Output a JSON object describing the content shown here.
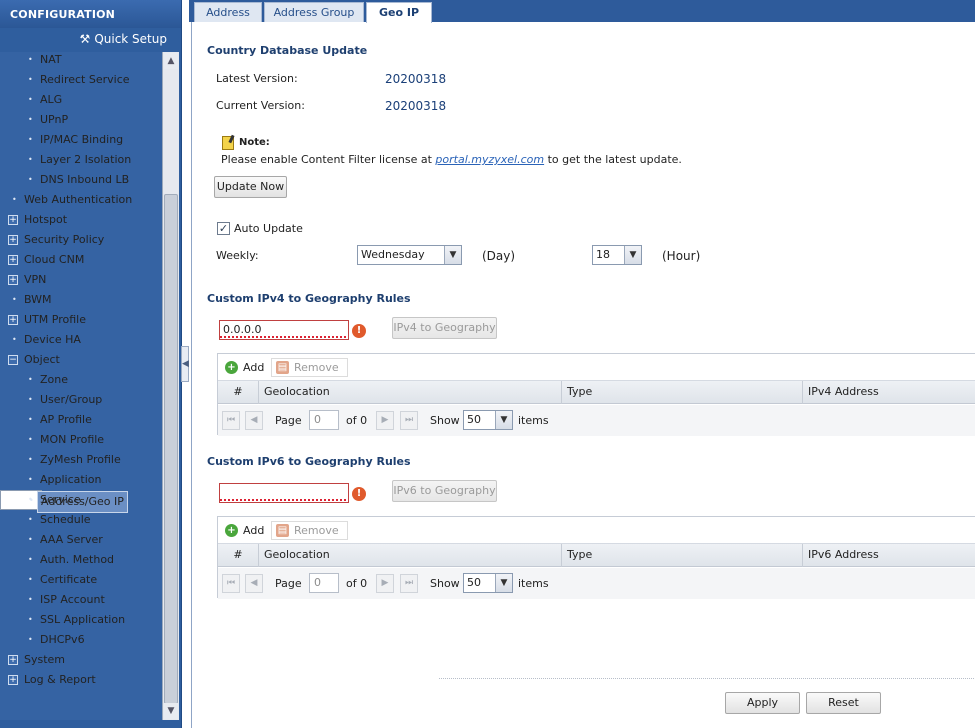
{
  "sidebar": {
    "header": "CONFIGURATION",
    "quick_setup": "Quick Setup",
    "items": [
      {
        "label": "NAT",
        "level": 2,
        "type": "leaf"
      },
      {
        "label": "Redirect Service",
        "level": 2,
        "type": "leaf"
      },
      {
        "label": "ALG",
        "level": 2,
        "type": "leaf"
      },
      {
        "label": "UPnP",
        "level": 2,
        "type": "leaf"
      },
      {
        "label": "IP/MAC Binding",
        "level": 2,
        "type": "leaf"
      },
      {
        "label": "Layer 2 Isolation",
        "level": 2,
        "type": "leaf"
      },
      {
        "label": "DNS Inbound LB",
        "level": 2,
        "type": "leaf"
      },
      {
        "label": "Web Authentication",
        "level": 1,
        "type": "leaf"
      },
      {
        "label": "Hotspot",
        "level": 1,
        "type": "expand"
      },
      {
        "label": "Security Policy",
        "level": 1,
        "type": "expand"
      },
      {
        "label": "Cloud CNM",
        "level": 1,
        "type": "expand"
      },
      {
        "label": "VPN",
        "level": 1,
        "type": "expand"
      },
      {
        "label": "BWM",
        "level": 1,
        "type": "leaf"
      },
      {
        "label": "UTM Profile",
        "level": 1,
        "type": "expand"
      },
      {
        "label": "Device HA",
        "level": 1,
        "type": "leaf"
      },
      {
        "label": "Object",
        "level": 1,
        "type": "collapse"
      },
      {
        "label": "Zone",
        "level": 2,
        "type": "leaf"
      },
      {
        "label": "User/Group",
        "level": 2,
        "type": "leaf"
      },
      {
        "label": "AP Profile",
        "level": 2,
        "type": "leaf"
      },
      {
        "label": "MON Profile",
        "level": 2,
        "type": "leaf"
      },
      {
        "label": "ZyMesh Profile",
        "level": 2,
        "type": "leaf"
      },
      {
        "label": "Application",
        "level": 2,
        "type": "leaf"
      },
      {
        "label": "Address/Geo IP",
        "level": 2,
        "type": "leaf",
        "selected": true
      },
      {
        "label": "Service",
        "level": 2,
        "type": "leaf"
      },
      {
        "label": "Schedule",
        "level": 2,
        "type": "leaf"
      },
      {
        "label": "AAA Server",
        "level": 2,
        "type": "leaf"
      },
      {
        "label": "Auth. Method",
        "level": 2,
        "type": "leaf"
      },
      {
        "label": "Certificate",
        "level": 2,
        "type": "leaf"
      },
      {
        "label": "ISP Account",
        "level": 2,
        "type": "leaf"
      },
      {
        "label": "SSL Application",
        "level": 2,
        "type": "leaf"
      },
      {
        "label": "DHCPv6",
        "level": 2,
        "type": "leaf"
      },
      {
        "label": "System",
        "level": 1,
        "type": "expand"
      },
      {
        "label": "Log & Report",
        "level": 1,
        "type": "expand"
      }
    ]
  },
  "tabs": [
    {
      "label": "Address",
      "active": false
    },
    {
      "label": "Address Group",
      "active": false
    },
    {
      "label": "Geo IP",
      "active": true
    }
  ],
  "country_db": {
    "title": "Country Database Update",
    "latest_label": "Latest Version:",
    "latest_value": "20200318",
    "current_label": "Current Version:",
    "current_value": "20200318",
    "note_label": "Note:",
    "note_pre": "Please enable Content Filter license at ",
    "note_link": "portal.myzyxel.com",
    "note_post": " to get the latest update.",
    "update_now": "Update Now",
    "auto_update_label": "Auto Update",
    "auto_update_checked": true,
    "weekly_label": "Weekly:",
    "day_value": "Wednesday",
    "day_unit": "(Day)",
    "hour_value": "18",
    "hour_unit": "(Hour)"
  },
  "ipv4": {
    "title": "Custom IPv4 to Geography Rules",
    "input_value": "0.0.0.0",
    "button": "IPv4 to Geography",
    "add": "Add",
    "remove": "Remove",
    "columns": [
      "#",
      "Geolocation",
      "Type",
      "IPv4 Address"
    ],
    "page_label": "Page",
    "page_value": "0",
    "of_label": "of 0",
    "show_label": "Show",
    "show_value": "50",
    "items_label": "items"
  },
  "ipv6": {
    "title": "Custom IPv6 to Geography Rules",
    "input_value": "",
    "button": "IPv6 to Geography",
    "add": "Add",
    "remove": "Remove",
    "columns": [
      "#",
      "Geolocation",
      "Type",
      "IPv6 Address"
    ],
    "page_label": "Page",
    "page_value": "0",
    "of_label": "of 0",
    "show_label": "Show",
    "show_value": "50",
    "items_label": "items"
  },
  "footer": {
    "apply": "Apply",
    "reset": "Reset"
  }
}
